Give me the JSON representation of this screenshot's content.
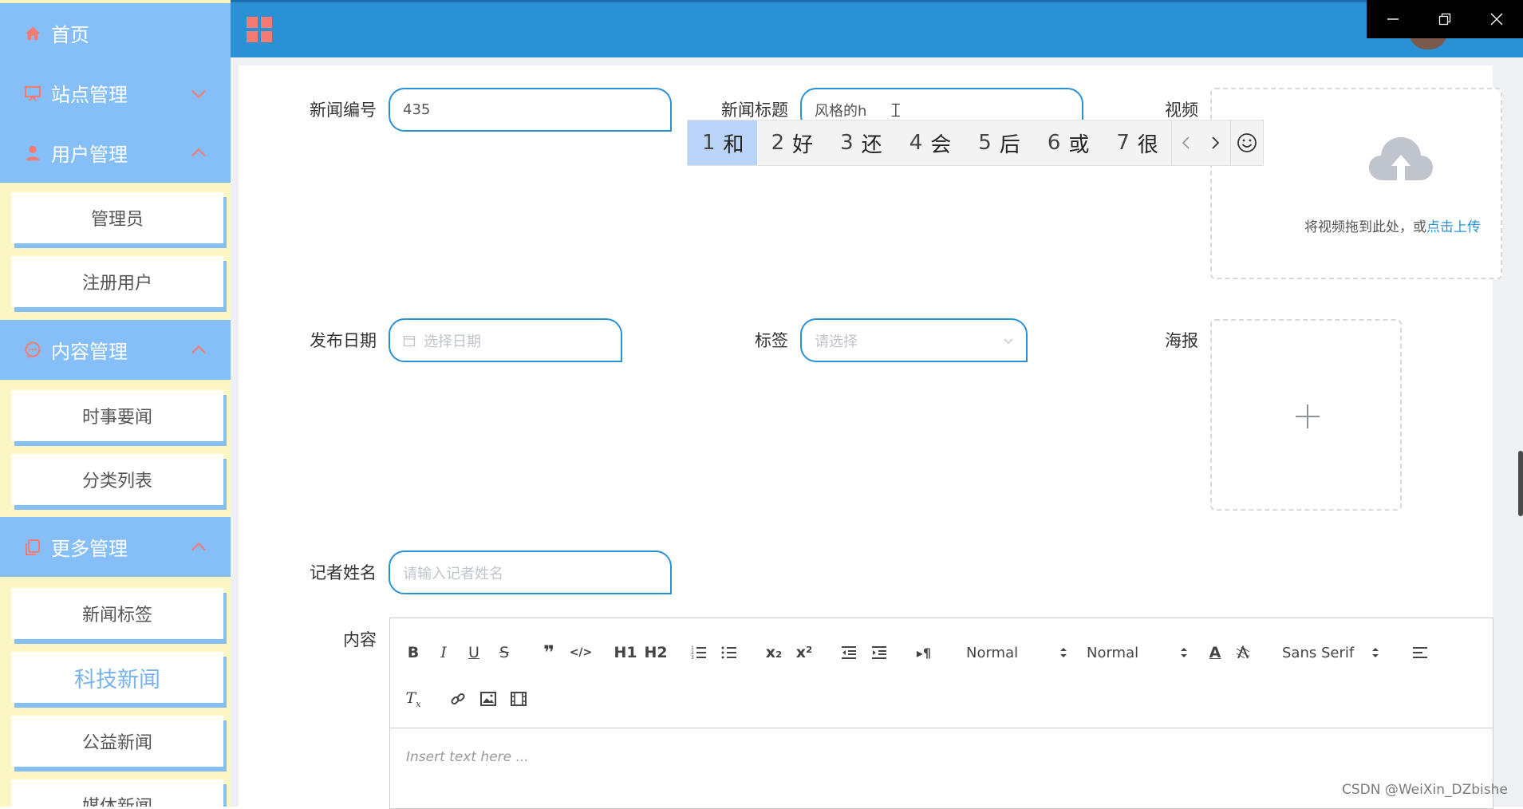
{
  "sidebar": {
    "home": {
      "label": "首页",
      "icon": "home-icon"
    },
    "site": {
      "label": "站点管理",
      "icon": "display-icon"
    },
    "user": {
      "label": "用户管理",
      "icon": "person-icon",
      "items": [
        "管理员",
        "注册用户"
      ]
    },
    "content": {
      "label": "内容管理",
      "icon": "chat-icon",
      "items": [
        "时事要闻",
        "分类列表"
      ]
    },
    "more": {
      "label": "更多管理",
      "icon": "copy-icon",
      "items": [
        "新闻标签",
        "科技新闻",
        "公益新闻",
        "媒体新闻"
      ]
    }
  },
  "form": {
    "news_no": {
      "label": "新闻编号",
      "value": "435"
    },
    "news_title": {
      "label": "新闻标题",
      "value": "风格的h"
    },
    "video": {
      "label": "视频",
      "upload_text": "将视频拖到此处，或",
      "upload_link": "点击上传"
    },
    "publish_date": {
      "label": "发布日期",
      "placeholder": "选择日期"
    },
    "tags": {
      "label": "标签",
      "placeholder": "请选择"
    },
    "poster": {
      "label": "海报"
    },
    "reporter": {
      "label": "记者姓名",
      "placeholder": "请输入记者姓名"
    },
    "content": {
      "label": "内容",
      "placeholder": "Insert text here ..."
    }
  },
  "ime": {
    "candidates": [
      {
        "n": "1",
        "c": "和"
      },
      {
        "n": "2",
        "c": "好"
      },
      {
        "n": "3",
        "c": "还"
      },
      {
        "n": "4",
        "c": "会"
      },
      {
        "n": "5",
        "c": "后"
      },
      {
        "n": "6",
        "c": "或"
      },
      {
        "n": "7",
        "c": "很"
      }
    ]
  },
  "editor": {
    "header_select": "Normal",
    "size_select": "Normal",
    "font_select": "Sans Serif",
    "buttons": {
      "bold": "B",
      "italic": "I",
      "underline": "U",
      "strike": "S",
      "quote": "❞",
      "code": "</>",
      "h1": "H1",
      "h2": "H2",
      "sub": "x₂",
      "sup": "x²",
      "direction": "▸¶",
      "font_color": "A"
    }
  },
  "colors": {
    "header_blue": "#2b91d5",
    "sidebar_blue": "#86bff7",
    "sidebar_bg": "#fbf6c4",
    "icon_red": "#f37b72"
  },
  "watermark": "CSDN @WeiXin_DZbishe"
}
